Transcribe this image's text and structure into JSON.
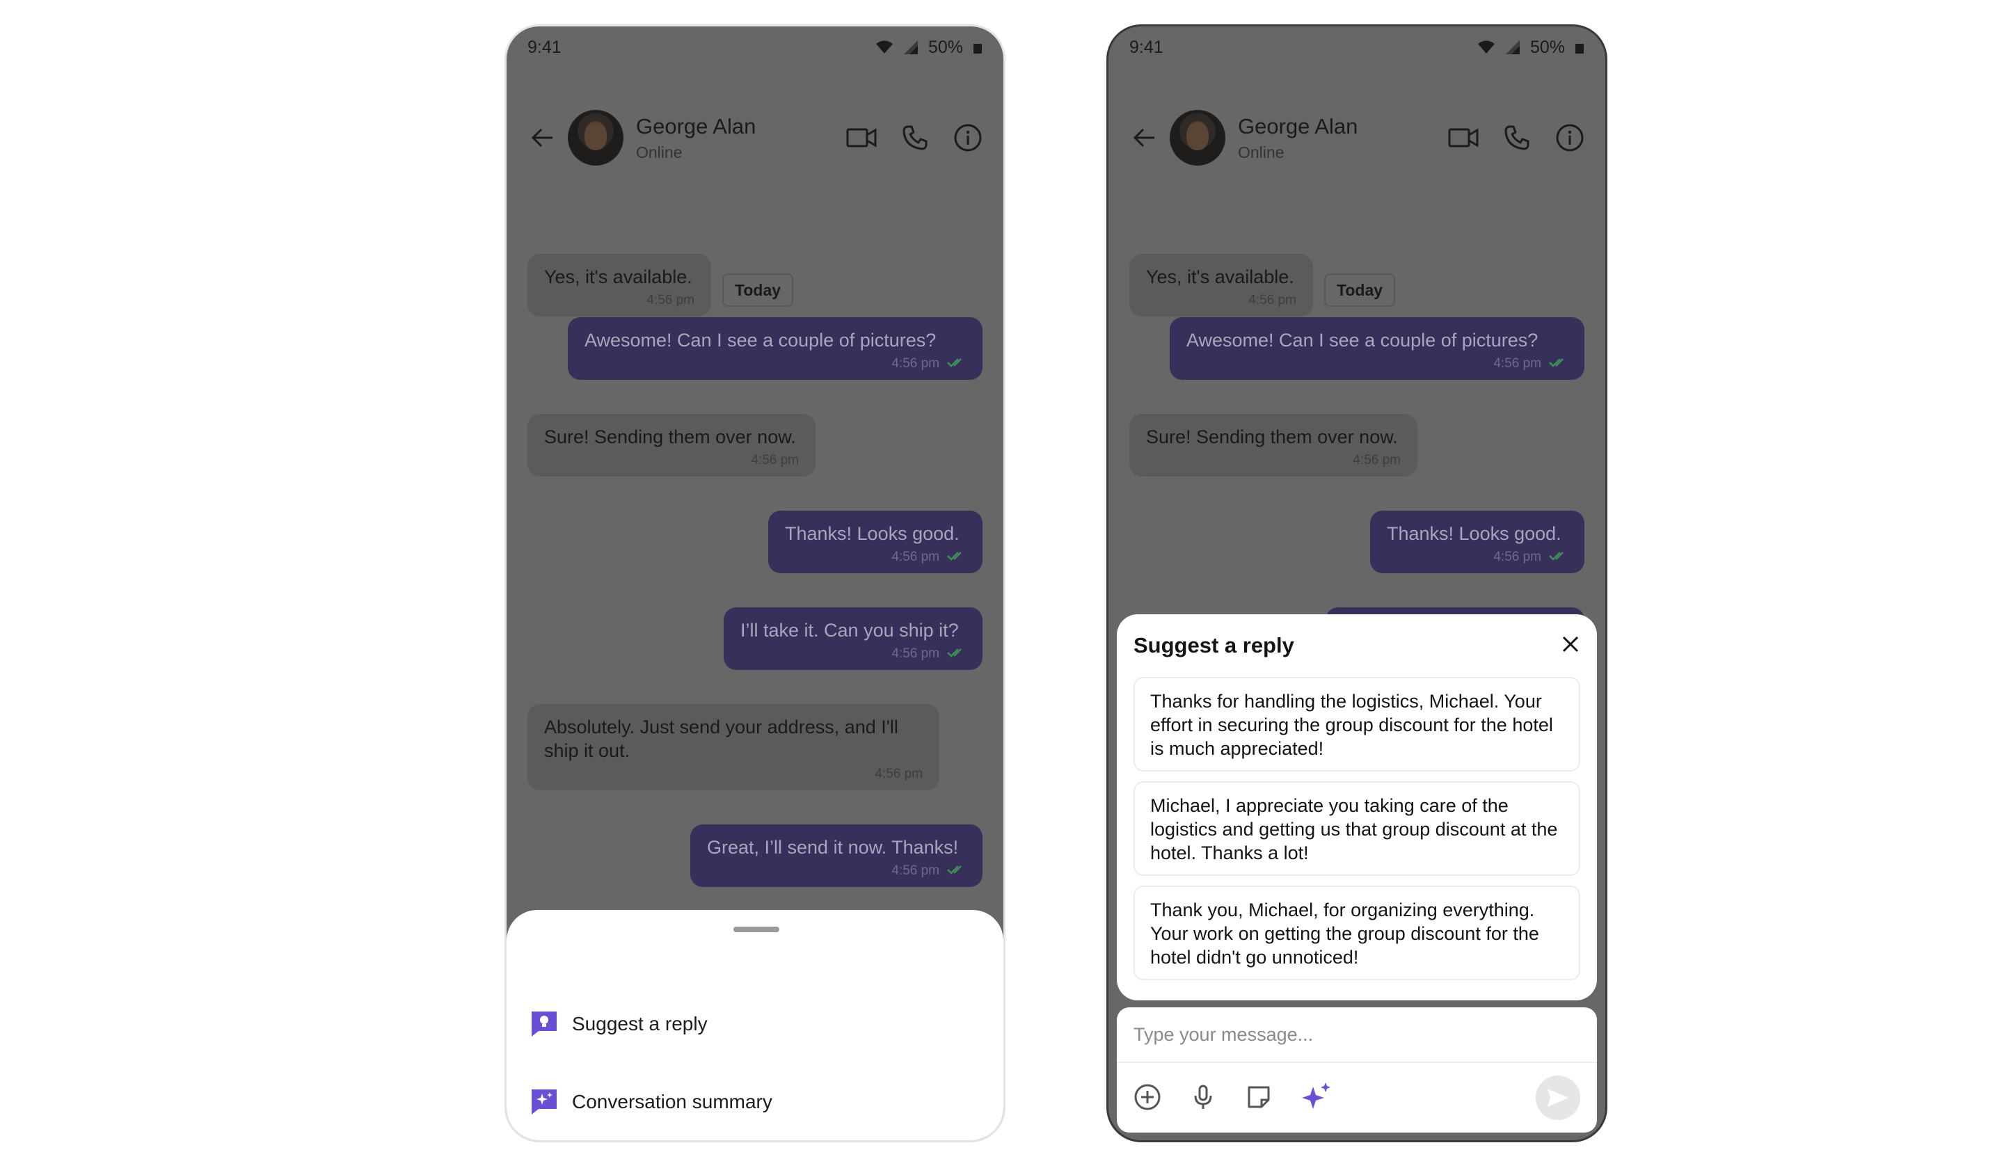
{
  "status_bar": {
    "time": "9:41",
    "battery": "50%"
  },
  "chat": {
    "contact_name": "George Alan",
    "contact_status": "Online",
    "date_chip": "Today",
    "messages": [
      {
        "dir": "in",
        "text": "Yes, it's available.",
        "time": "4:56 pm"
      },
      {
        "dir": "out",
        "text": "Awesome! Can I see a couple of pictures?",
        "time": "4:56 pm"
      },
      {
        "dir": "in",
        "text": "Sure! Sending them over now.",
        "time": "4:56 pm"
      },
      {
        "dir": "out",
        "text": "Thanks! Looks good.",
        "time": "4:56 pm"
      },
      {
        "dir": "out",
        "text": "I’ll take it. Can you ship it?",
        "time": "4:56 pm"
      },
      {
        "dir": "in",
        "text": "Absolutely. Just send your address, and I'll ship it out.",
        "time": "4:56 pm"
      },
      {
        "dir": "out",
        "text": "Great, I’ll send it now. Thanks!",
        "time": "4:56 pm"
      }
    ]
  },
  "sheet": {
    "items": [
      {
        "label": "Suggest a reply",
        "icon": "suggest-reply-icon"
      },
      {
        "label": "Conversation summary",
        "icon": "conversation-summary-icon"
      }
    ]
  },
  "suggest_panel": {
    "title": "Suggest a reply",
    "suggestions": [
      "Thanks for handling the logistics, Michael. Your effort in securing the group discount for the hotel is much appreciated!",
      "Michael, I appreciate you taking care of the logistics and getting us that group discount at the hotel. Thanks a lot!",
      "Thank you, Michael, for organizing everything. Your work on getting the group discount for the hotel didn't go unnoticed!"
    ]
  },
  "composer": {
    "placeholder": "Type your message..."
  },
  "colors": {
    "accent": "#6a4fd4",
    "outgoing_bubble_dimmed": "#37305a",
    "overlay": "#676767"
  }
}
